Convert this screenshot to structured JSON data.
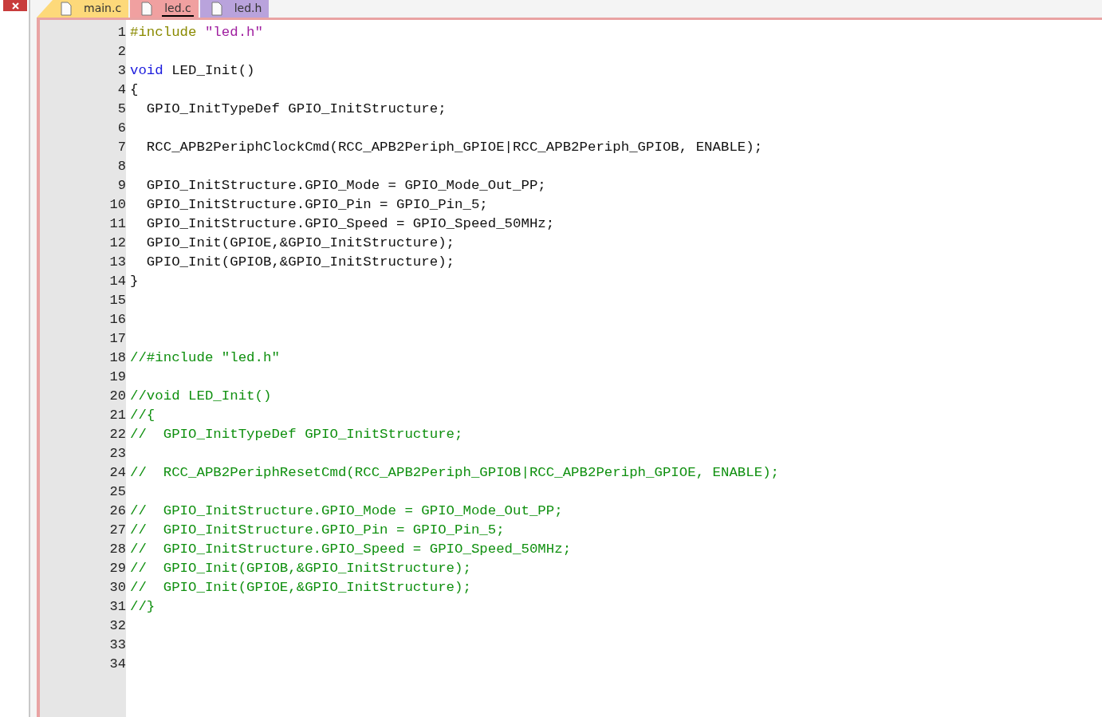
{
  "tabs": [
    {
      "label": "main.c",
      "selected": false,
      "color": "#fdd97a"
    },
    {
      "label": "led.c",
      "selected": true,
      "color": "#f0a0a0"
    },
    {
      "label": "led.h",
      "selected": false,
      "color": "#b9a3dc"
    }
  ],
  "editor": {
    "lines": [
      {
        "number": "1",
        "tokens": [
          {
            "kind": "preprocessor",
            "text": "#include"
          },
          {
            "kind": "string",
            "text": " \"led.h\""
          }
        ]
      },
      {
        "number": "2"
      },
      {
        "number": "3",
        "tokens": [
          {
            "kind": "keyword",
            "text": "void"
          },
          {
            "kind": "plain",
            "text": " LED_Init()"
          }
        ]
      },
      {
        "number": "4",
        "tokens": [
          {
            "kind": "plain",
            "text": "{"
          }
        ]
      },
      {
        "number": "5",
        "tokens": [
          {
            "kind": "plain",
            "text": "  GPIO_InitTypeDef GPIO_InitStructure;"
          }
        ]
      },
      {
        "number": "6"
      },
      {
        "number": "7",
        "tokens": [
          {
            "kind": "plain",
            "text": "  RCC_APB2PeriphClockCmd(RCC_APB2Periph_GPIOE|RCC_APB2Periph_GPIOB, ENABLE);"
          }
        ]
      },
      {
        "number": "8"
      },
      {
        "number": "9",
        "tokens": [
          {
            "kind": "plain",
            "text": "  GPIO_InitStructure.GPIO_Mode = GPIO_Mode_Out_PP;"
          }
        ]
      },
      {
        "number": "10",
        "tokens": [
          {
            "kind": "plain",
            "text": "  GPIO_InitStructure.GPIO_Pin = GPIO_Pin_5;"
          }
        ]
      },
      {
        "number": "11",
        "tokens": [
          {
            "kind": "plain",
            "text": "  GPIO_InitStructure.GPIO_Speed = GPIO_Speed_50MHz;"
          }
        ]
      },
      {
        "number": "12",
        "tokens": [
          {
            "kind": "plain",
            "text": "  GPIO_Init(GPIOE,&GPIO_InitStructure);"
          }
        ]
      },
      {
        "number": "13",
        "tokens": [
          {
            "kind": "plain",
            "text": "  GPIO_Init(GPIOB,&GPIO_InitStructure);"
          }
        ]
      },
      {
        "number": "14",
        "tokens": [
          {
            "kind": "plain",
            "text": "}"
          }
        ]
      },
      {
        "number": "15"
      },
      {
        "number": "16"
      },
      {
        "number": "17"
      },
      {
        "number": "18",
        "tokens": [
          {
            "kind": "comment",
            "text": "//#include \"led.h\""
          }
        ]
      },
      {
        "number": "19"
      },
      {
        "number": "20",
        "tokens": [
          {
            "kind": "comment",
            "text": "//void LED_Init()"
          }
        ]
      },
      {
        "number": "21",
        "tokens": [
          {
            "kind": "comment",
            "text": "//{"
          }
        ]
      },
      {
        "number": "22",
        "tokens": [
          {
            "kind": "comment",
            "text": "//  GPIO_InitTypeDef GPIO_InitStructure;"
          }
        ]
      },
      {
        "number": "23"
      },
      {
        "number": "24",
        "tokens": [
          {
            "kind": "comment",
            "text": "//  RCC_APB2PeriphResetCmd(RCC_APB2Periph_GPIOB|RCC_APB2Periph_GPIOE, ENABLE);"
          }
        ]
      },
      {
        "number": "25"
      },
      {
        "number": "26",
        "tokens": [
          {
            "kind": "comment",
            "text": "//  GPIO_InitStructure.GPIO_Mode = GPIO_Mode_Out_PP;"
          }
        ]
      },
      {
        "number": "27",
        "tokens": [
          {
            "kind": "comment",
            "text": "//  GPIO_InitStructure.GPIO_Pin = GPIO_Pin_5;"
          }
        ]
      },
      {
        "number": "28",
        "tokens": [
          {
            "kind": "comment",
            "text": "//  GPIO_InitStructure.GPIO_Speed = GPIO_Speed_50MHz;"
          }
        ]
      },
      {
        "number": "29",
        "tokens": [
          {
            "kind": "comment",
            "text": "//  GPIO_Init(GPIOB,&GPIO_InitStructure);"
          }
        ]
      },
      {
        "number": "30",
        "tokens": [
          {
            "kind": "comment",
            "text": "//  GPIO_Init(GPIOE,&GPIO_InitStructure);"
          }
        ]
      },
      {
        "number": "31",
        "tokens": [
          {
            "kind": "comment",
            "text": "//}"
          }
        ]
      },
      {
        "number": "32"
      },
      {
        "number": "33"
      },
      {
        "number": "34"
      }
    ]
  }
}
